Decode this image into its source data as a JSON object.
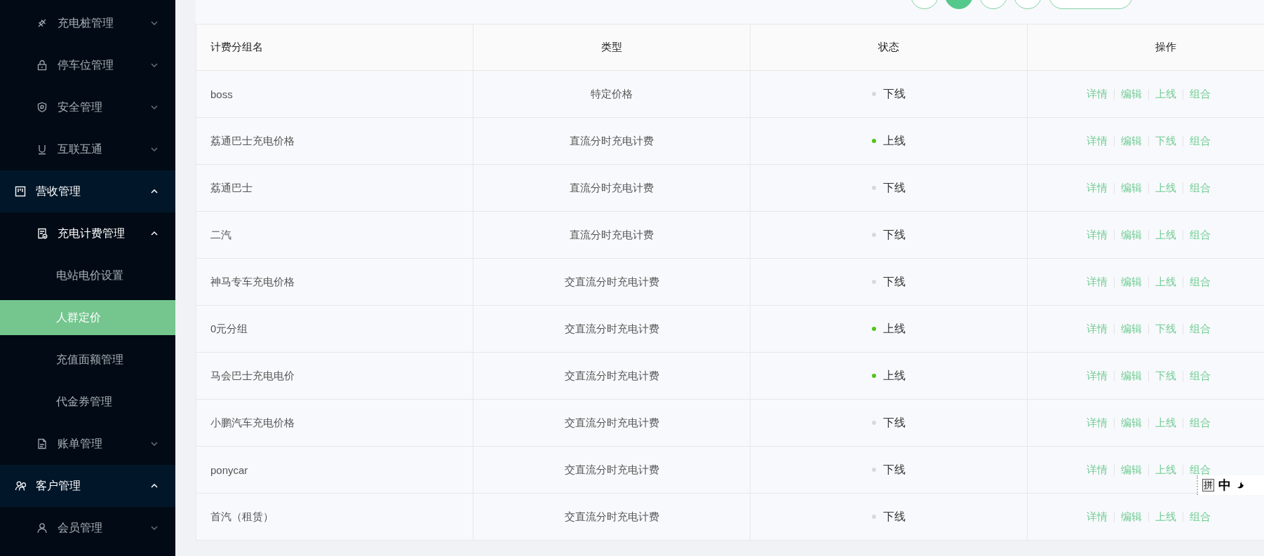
{
  "sidebar": {
    "items": [
      {
        "label": "充电桩管理",
        "kind": "submenu",
        "expanded": false
      },
      {
        "label": "停车位管理",
        "kind": "submenu",
        "expanded": false
      },
      {
        "label": "安全管理",
        "kind": "submenu",
        "expanded": false
      },
      {
        "label": "互联互通",
        "kind": "submenu",
        "expanded": false
      },
      {
        "label": "营收管理",
        "kind": "group",
        "expanded": true,
        "children": [
          {
            "label": "充电计费管理",
            "kind": "submenu",
            "expanded": true,
            "children": [
              {
                "label": "电站电价设置",
                "kind": "page",
                "selected": false
              },
              {
                "label": "人群定价",
                "kind": "page",
                "selected": true
              },
              {
                "label": "充值面额管理",
                "kind": "page",
                "selected": false
              },
              {
                "label": "代金券管理",
                "kind": "page",
                "selected": false
              }
            ]
          },
          {
            "label": "账单管理",
            "kind": "submenu",
            "expanded": false
          }
        ]
      },
      {
        "label": "客户管理",
        "kind": "group",
        "expanded": true,
        "children": [
          {
            "label": "会员管理",
            "kind": "submenu",
            "expanded": false
          }
        ]
      }
    ]
  },
  "pagination": {
    "pages": [
      {
        "selected": true
      },
      {
        "selected": false
      }
    ]
  },
  "table": {
    "columns": [
      "计费分组名",
      "类型",
      "状态",
      "操作"
    ],
    "rows": [
      {
        "name": "boss",
        "type": "特定价格",
        "status": "下线",
        "online": false,
        "actions": [
          "详情",
          "编辑",
          "上线",
          "组合"
        ]
      },
      {
        "name": "荔通巴士充电价格",
        "type": "直流分时充电计费",
        "status": "上线",
        "online": true,
        "actions": [
          "详情",
          "编辑",
          "下线",
          "组合"
        ]
      },
      {
        "name": "荔通巴士",
        "type": "直流分时充电计费",
        "status": "下线",
        "online": false,
        "actions": [
          "详情",
          "编辑",
          "上线",
          "组合"
        ]
      },
      {
        "name": "二汽",
        "type": "直流分时充电计费",
        "status": "下线",
        "online": false,
        "actions": [
          "详情",
          "编辑",
          "上线",
          "组合"
        ]
      },
      {
        "name": "神马专车充电价格",
        "type": "交直流分时充电计费",
        "status": "下线",
        "online": false,
        "actions": [
          "详情",
          "编辑",
          "上线",
          "组合"
        ]
      },
      {
        "name": "0元分组",
        "type": "交直流分时充电计费",
        "status": "上线",
        "online": true,
        "actions": [
          "详情",
          "编辑",
          "下线",
          "组合"
        ]
      },
      {
        "name": "马会巴士充电电价",
        "type": "交直流分时充电计费",
        "status": "上线",
        "online": true,
        "actions": [
          "详情",
          "编辑",
          "下线",
          "组合"
        ]
      },
      {
        "name": "小鹏汽车充电价格",
        "type": "交直流分时充电计费",
        "status": "下线",
        "online": false,
        "actions": [
          "详情",
          "编辑",
          "上线",
          "组合"
        ]
      },
      {
        "name": "ponycar",
        "type": "交直流分时充电计费",
        "status": "下线",
        "online": false,
        "actions": [
          "详情",
          "编辑",
          "上线",
          "组合"
        ]
      },
      {
        "name": "首汽（租赁）",
        "type": "交直流分时充电计费",
        "status": "下线",
        "online": false,
        "actions": [
          "详情",
          "编辑",
          "上线",
          "组合"
        ]
      }
    ]
  },
  "ime_bar": {
    "mode": "拼",
    "language": "中"
  }
}
